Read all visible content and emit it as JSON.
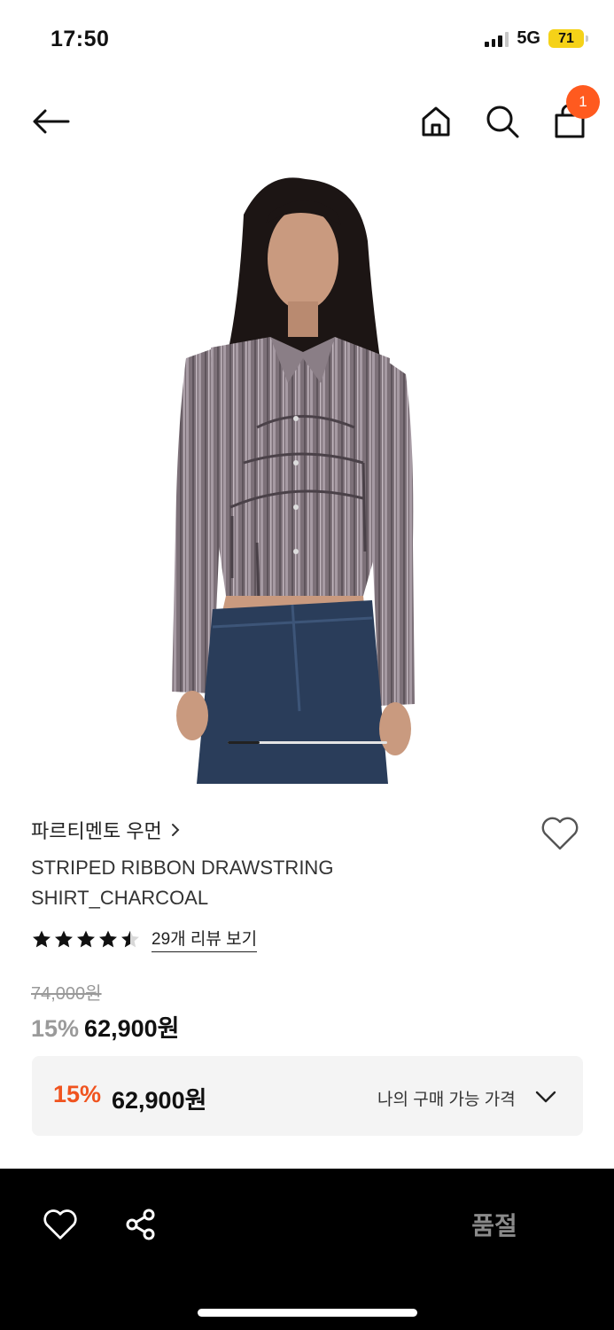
{
  "status": {
    "time": "17:50",
    "network": "5G",
    "battery": "71"
  },
  "nav": {
    "cart_count": "1"
  },
  "product": {
    "brand": "파르티멘토 우먼",
    "name_line1": "STRIPED RIBBON DRAWSTRING",
    "name_line2": "SHIRT_CHARCOAL",
    "rating": 4.5,
    "review_link": "29개 리뷰 보기",
    "original_price": "74,000원",
    "discount": "15%",
    "price": "62,900원",
    "image_position": 0.2
  },
  "price_box": {
    "discount": "15%",
    "price": "62,900원",
    "label": "나의 구매 가능 가격"
  },
  "bottom": {
    "soldout_label": "품절"
  },
  "colors": {
    "accent": "#f0531f",
    "badge": "#ff5a1f",
    "battery": "#f5d218"
  }
}
